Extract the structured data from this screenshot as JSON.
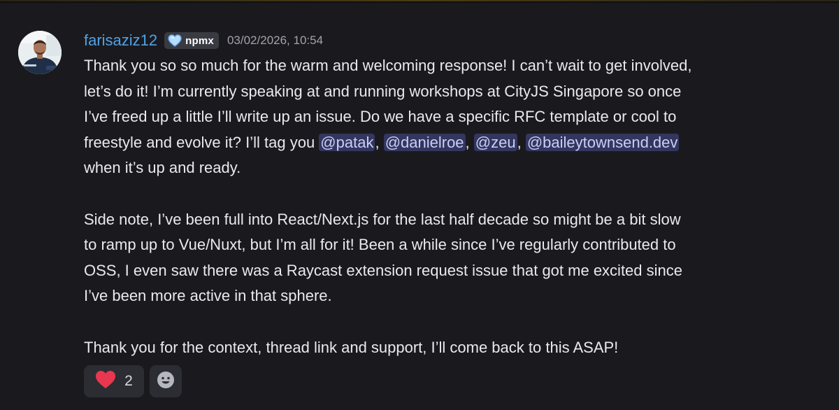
{
  "message": {
    "author": "farisaziz12",
    "server_tag": "npmx",
    "timestamp": "03/02/2026, 10:54",
    "avatar": "avatar-photo",
    "paragraph1": {
      "line1": "Thank you so so much for the warm and welcoming response! I can’t wait to get involved,",
      "line2": "let’s do it! I’m currently speaking at and running workshops at CityJS Singapore so once",
      "line3": "I’ve freed up a little I’ll write up an issue. Do we have a specific RFC template or cool to",
      "line4_prefix": "freestyle and evolve it? I’ll tag you ",
      "sep": ", ",
      "line5": "when it’s up and ready."
    },
    "mentions": [
      "@patak",
      "@danielroe",
      "@zeu",
      "@baileytownsend.dev"
    ],
    "paragraph2": {
      "line1": "Side note, I’ve been full into React/Next.js for the last half decade so might be a bit slow",
      "line2": "to ramp up to Vue/Nuxt, but I’m all for it! Been a while since I’ve regularly contributed to",
      "line3": "OSS, I even saw there was a Raycast extension request issue that got me excited since",
      "line4": "I’ve been more active in that sphere."
    },
    "paragraph3": {
      "line1": "Thank you for the context, thread link and support, I’ll come back to this ASAP!"
    }
  },
  "reactions": [
    {
      "emoji": "heart-icon",
      "count": "2"
    }
  ],
  "add_reaction_icon": "smiley-icon",
  "colors": {
    "background": "#1a1a1e",
    "username": "#4ea3e6",
    "mention_bg": "#33375e",
    "mention_text": "#c9cdfb",
    "heart": "#e8374f"
  }
}
